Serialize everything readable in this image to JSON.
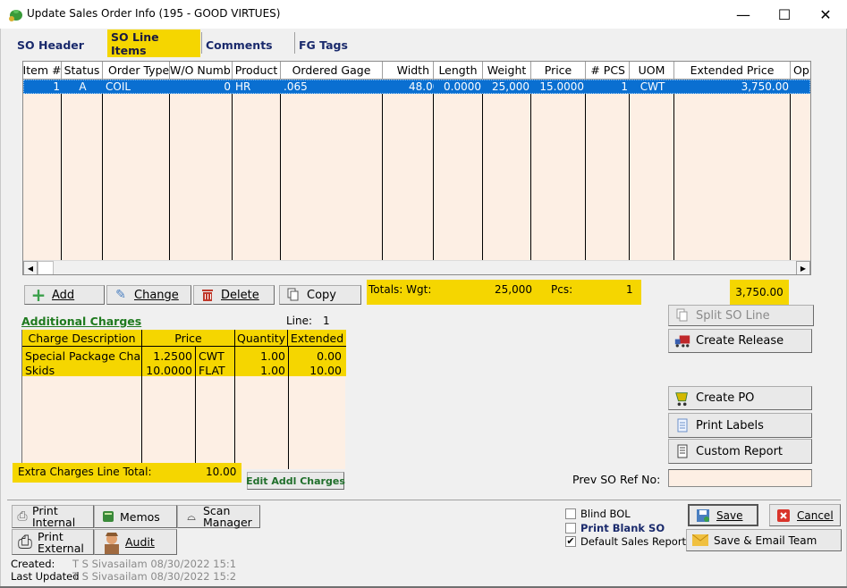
{
  "window": {
    "title": "Update Sales Order Info  (195 - GOOD VIRTUES)",
    "minimize_label": "—",
    "maximize_label": "☐",
    "close_label": "✕"
  },
  "tabs": [
    {
      "label": "SO Header",
      "active": false
    },
    {
      "label": "SO Line Items",
      "active": true
    },
    {
      "label": "Comments",
      "active": false
    },
    {
      "label": "FG Tags",
      "active": false
    }
  ],
  "line_items": {
    "columns": [
      "Item #",
      "Status",
      "Order Type",
      "W/O Numb",
      "Product",
      "Ordered Gage",
      "Width",
      "Length",
      "Weight",
      "Price",
      "# PCS",
      "UOM",
      "Extended Price",
      "Op"
    ],
    "rows": [
      {
        "item": "1",
        "status": "A",
        "order_type": "COIL",
        "wo_number": "0",
        "product": "HR",
        "ordered_gage": ".065",
        "width": "48.0000",
        "length": "0.0000",
        "weight": "25,000",
        "price": "15.0000",
        "pcs": "1",
        "uom": "CWT",
        "extended_price": "3,750.00",
        "op": ""
      }
    ],
    "selected_row": 0
  },
  "line_actions": {
    "add": "Add",
    "change": "Change",
    "delete": "Delete",
    "copy": "Copy"
  },
  "totals": {
    "label": "Totals:  Wgt:",
    "weight": "25,000",
    "pcs_label": "Pcs:",
    "pcs": "1",
    "extended": "3,750.00"
  },
  "additional_charges": {
    "title": "Additional Charges",
    "line_label": "Line:",
    "line_value": "1",
    "columns": [
      "Charge Description",
      "Price",
      "Quantity",
      "Extended"
    ],
    "rows": [
      {
        "description": "Special Package Charge",
        "price": "1.2500",
        "uom": "CWT",
        "quantity": "1.00",
        "extended": "0.00"
      },
      {
        "description": "Skids",
        "price": "10.0000",
        "uom": "FLAT",
        "quantity": "1.00",
        "extended": "10.00"
      }
    ],
    "total_label": "Extra Charges Line Total:",
    "total_value": "10.00",
    "edit_button": "Edit Addl Charges"
  },
  "side_actions": {
    "split": "Split SO Line",
    "create_release": "Create Release",
    "create_po": "Create PO",
    "print_labels": "Print Labels",
    "custom_report": "Custom Report",
    "prev_so_label": "Prev SO Ref No:",
    "prev_so_value": ""
  },
  "footer": {
    "print_internal": "Print Internal",
    "print_external": "Print External",
    "memos": "Memos",
    "audit": "Audit",
    "scan_manager": "Scan Manager",
    "created_label": "Created:",
    "created_value": "T S Sivasailam 08/30/2022 15:1",
    "updated_label": "Last Updated",
    "updated_value": "T S Sivasailam 08/30/2022 15:2",
    "blind_bol": {
      "label": "Blind BOL",
      "checked": false
    },
    "print_blank_so": {
      "label": "Print Blank SO",
      "checked": false
    },
    "default_sales_report": {
      "label": "Default Sales Report",
      "checked": true
    },
    "save": "Save",
    "cancel": "Cancel",
    "save_email": "Save & Email Team"
  },
  "colors": {
    "highlight": "#f5d600",
    "grid_bg": "#fdefe4",
    "selection": "#0a6fd1",
    "link_green": "#1f7a1f",
    "tab_text": "#1a2a6c"
  }
}
